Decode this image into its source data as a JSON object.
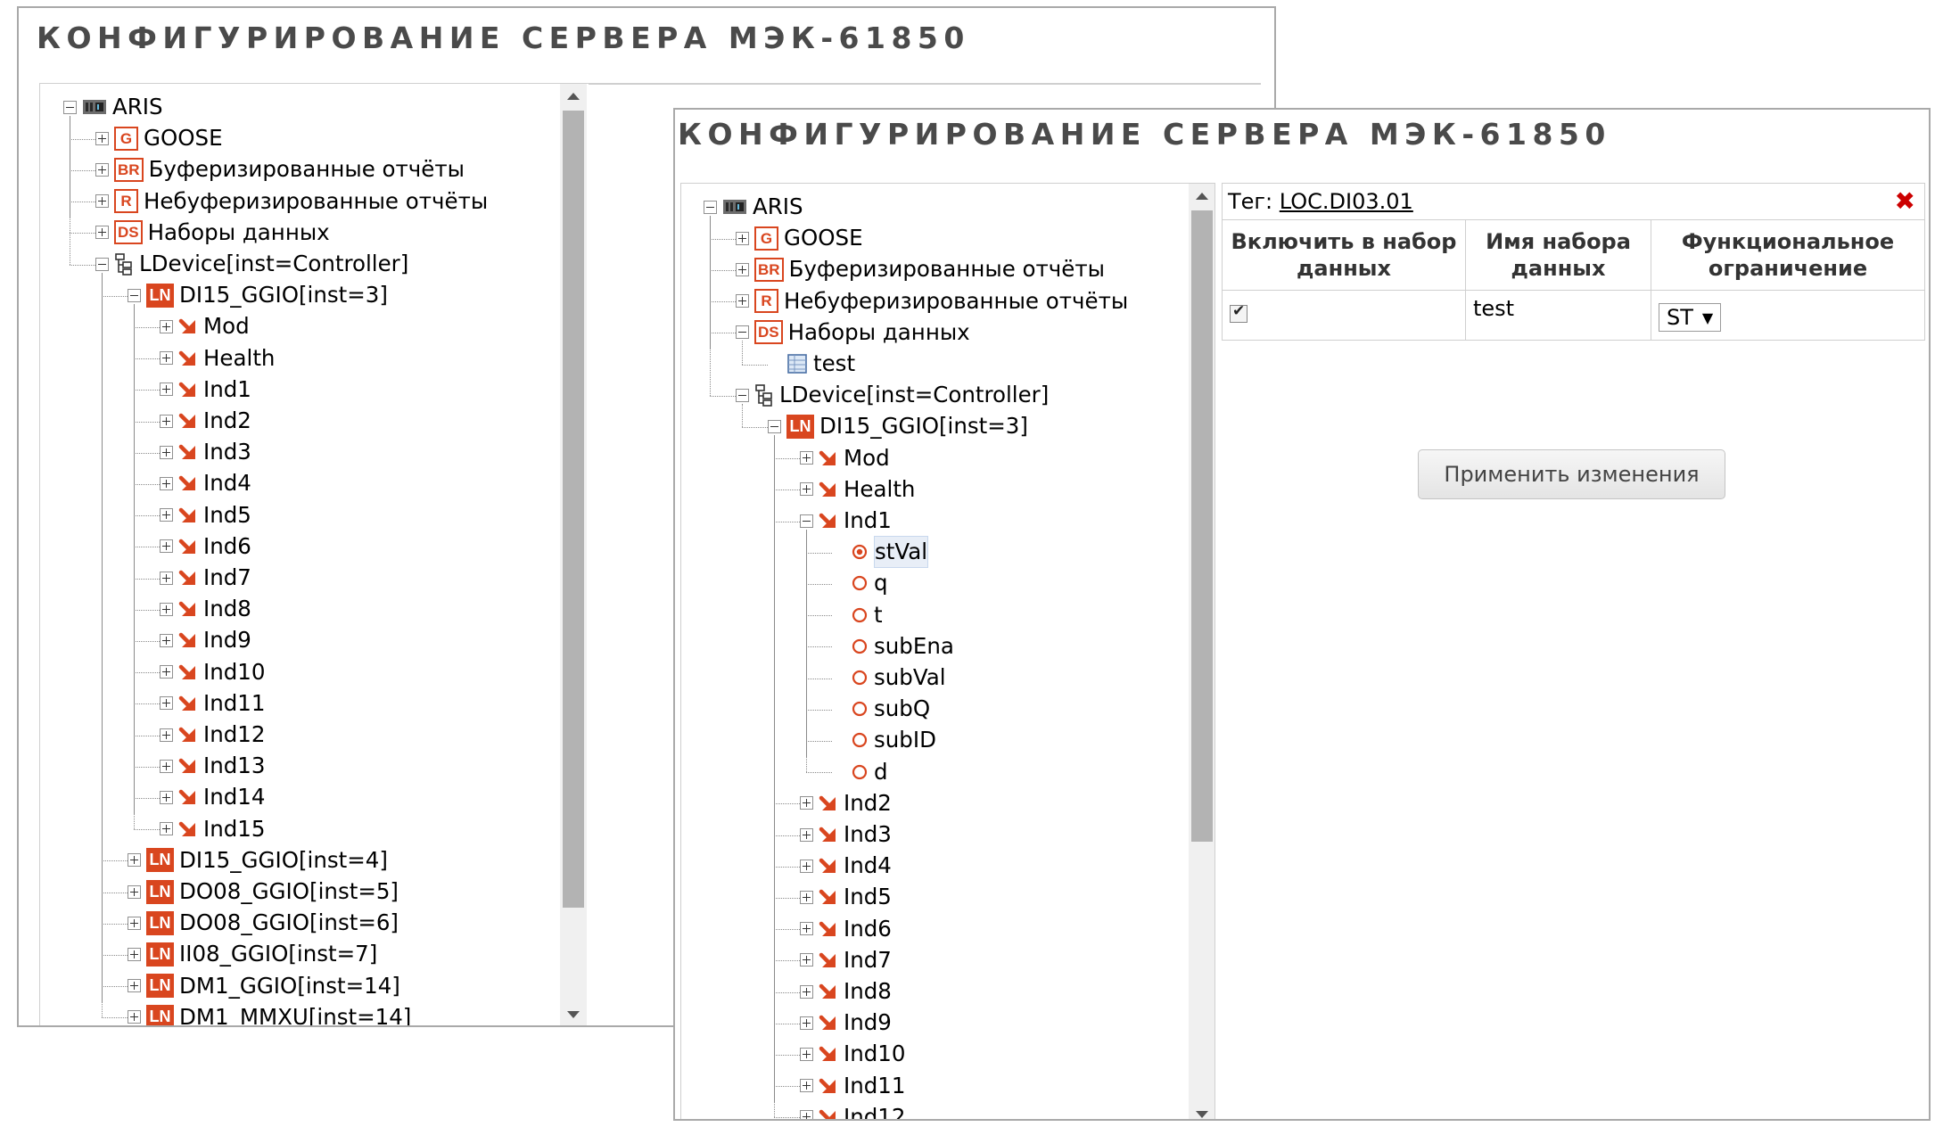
{
  "title": "КОНФИГУРИРОВАНИЕ СЕРВЕРА МЭК-61850",
  "back_tree": [
    {
      "depth": 0,
      "expander": "minus",
      "icon": "server-icon",
      "label": "ARIS"
    },
    {
      "depth": 1,
      "expander": "plus",
      "icon": "G",
      "label": "GOOSE"
    },
    {
      "depth": 1,
      "expander": "plus",
      "icon": "BR",
      "label": "Буферизированные отчёты"
    },
    {
      "depth": 1,
      "expander": "plus",
      "icon": "R",
      "label": "Небуферизированные отчёты"
    },
    {
      "depth": 1,
      "expander": "plus",
      "icon": "DS",
      "label": "Наборы данных"
    },
    {
      "depth": 1,
      "expander": "minus",
      "icon": "ldevice-icon",
      "label": "LDevice[inst=Controller]"
    },
    {
      "depth": 2,
      "expander": "minus",
      "icon": "LN",
      "label": "DI15_GGIO[inst=3]"
    },
    {
      "depth": 3,
      "expander": "plus",
      "icon": "arrow-icon",
      "label": "Mod"
    },
    {
      "depth": 3,
      "expander": "plus",
      "icon": "arrow-icon",
      "label": "Health"
    },
    {
      "depth": 3,
      "expander": "plus",
      "icon": "arrow-icon",
      "label": "Ind1"
    },
    {
      "depth": 3,
      "expander": "plus",
      "icon": "arrow-icon",
      "label": "Ind2"
    },
    {
      "depth": 3,
      "expander": "plus",
      "icon": "arrow-icon",
      "label": "Ind3"
    },
    {
      "depth": 3,
      "expander": "plus",
      "icon": "arrow-icon",
      "label": "Ind4"
    },
    {
      "depth": 3,
      "expander": "plus",
      "icon": "arrow-icon",
      "label": "Ind5"
    },
    {
      "depth": 3,
      "expander": "plus",
      "icon": "arrow-icon",
      "label": "Ind6"
    },
    {
      "depth": 3,
      "expander": "plus",
      "icon": "arrow-icon",
      "label": "Ind7"
    },
    {
      "depth": 3,
      "expander": "plus",
      "icon": "arrow-icon",
      "label": "Ind8"
    },
    {
      "depth": 3,
      "expander": "plus",
      "icon": "arrow-icon",
      "label": "Ind9"
    },
    {
      "depth": 3,
      "expander": "plus",
      "icon": "arrow-icon",
      "label": "Ind10"
    },
    {
      "depth": 3,
      "expander": "plus",
      "icon": "arrow-icon",
      "label": "Ind11"
    },
    {
      "depth": 3,
      "expander": "plus",
      "icon": "arrow-icon",
      "label": "Ind12"
    },
    {
      "depth": 3,
      "expander": "plus",
      "icon": "arrow-icon",
      "label": "Ind13"
    },
    {
      "depth": 3,
      "expander": "plus",
      "icon": "arrow-icon",
      "label": "Ind14"
    },
    {
      "depth": 3,
      "expander": "plus",
      "icon": "arrow-icon",
      "label": "Ind15"
    },
    {
      "depth": 2,
      "expander": "plus",
      "icon": "LN",
      "label": "DI15_GGIO[inst=4]"
    },
    {
      "depth": 2,
      "expander": "plus",
      "icon": "LN",
      "label": "DO08_GGIO[inst=5]"
    },
    {
      "depth": 2,
      "expander": "plus",
      "icon": "LN",
      "label": "DO08_GGIO[inst=6]"
    },
    {
      "depth": 2,
      "expander": "plus",
      "icon": "LN",
      "label": "II08_GGIO[inst=7]"
    },
    {
      "depth": 2,
      "expander": "plus",
      "icon": "LN",
      "label": "DM1_GGIO[inst=14]"
    },
    {
      "depth": 2,
      "expander": "plus",
      "icon": "LN",
      "label": "DM1_MMXU[inst=14]"
    }
  ],
  "front_tree": [
    {
      "depth": 0,
      "expander": "minus",
      "icon": "server-icon",
      "label": "ARIS"
    },
    {
      "depth": 1,
      "expander": "plus",
      "icon": "G",
      "label": "GOOSE"
    },
    {
      "depth": 1,
      "expander": "plus",
      "icon": "BR",
      "label": "Буферизированные отчёты"
    },
    {
      "depth": 1,
      "expander": "plus",
      "icon": "R",
      "label": "Небуферизированные отчёты"
    },
    {
      "depth": 1,
      "expander": "minus",
      "icon": "DS",
      "label": "Наборы данных"
    },
    {
      "depth": 2,
      "expander": "none",
      "icon": "dataset-icon",
      "label": "test"
    },
    {
      "depth": 1,
      "expander": "minus",
      "icon": "ldevice-icon",
      "label": "LDevice[inst=Controller]"
    },
    {
      "depth": 2,
      "expander": "minus",
      "icon": "LN",
      "label": "DI15_GGIO[inst=3]"
    },
    {
      "depth": 3,
      "expander": "plus",
      "icon": "arrow-icon",
      "label": "Mod"
    },
    {
      "depth": 3,
      "expander": "plus",
      "icon": "arrow-icon",
      "label": "Health"
    },
    {
      "depth": 3,
      "expander": "minus",
      "icon": "arrow-icon",
      "label": "Ind1"
    },
    {
      "depth": 4,
      "expander": "none",
      "icon": "radio-selected-icon",
      "label": "stVal",
      "selected": true
    },
    {
      "depth": 4,
      "expander": "none",
      "icon": "radio-icon",
      "label": "q"
    },
    {
      "depth": 4,
      "expander": "none",
      "icon": "radio-icon",
      "label": "t"
    },
    {
      "depth": 4,
      "expander": "none",
      "icon": "radio-icon",
      "label": "subEna"
    },
    {
      "depth": 4,
      "expander": "none",
      "icon": "radio-icon",
      "label": "subVal"
    },
    {
      "depth": 4,
      "expander": "none",
      "icon": "radio-icon",
      "label": "subQ"
    },
    {
      "depth": 4,
      "expander": "none",
      "icon": "radio-icon",
      "label": "subID"
    },
    {
      "depth": 4,
      "expander": "none",
      "icon": "radio-icon",
      "label": "d"
    },
    {
      "depth": 3,
      "expander": "plus",
      "icon": "arrow-icon",
      "label": "Ind2"
    },
    {
      "depth": 3,
      "expander": "plus",
      "icon": "arrow-icon",
      "label": "Ind3"
    },
    {
      "depth": 3,
      "expander": "plus",
      "icon": "arrow-icon",
      "label": "Ind4"
    },
    {
      "depth": 3,
      "expander": "plus",
      "icon": "arrow-icon",
      "label": "Ind5"
    },
    {
      "depth": 3,
      "expander": "plus",
      "icon": "arrow-icon",
      "label": "Ind6"
    },
    {
      "depth": 3,
      "expander": "plus",
      "icon": "arrow-icon",
      "label": "Ind7"
    },
    {
      "depth": 3,
      "expander": "plus",
      "icon": "arrow-icon",
      "label": "Ind8"
    },
    {
      "depth": 3,
      "expander": "plus",
      "icon": "arrow-icon",
      "label": "Ind9"
    },
    {
      "depth": 3,
      "expander": "plus",
      "icon": "arrow-icon",
      "label": "Ind10"
    },
    {
      "depth": 3,
      "expander": "plus",
      "icon": "arrow-icon",
      "label": "Ind11"
    },
    {
      "depth": 3,
      "expander": "plus",
      "icon": "arrow-icon",
      "label": "Ind12"
    }
  ],
  "details": {
    "tag_label": "Тег:",
    "tag_value": "LOC.DI03.01",
    "close_symbol": "✖",
    "headers": [
      "Включить в набор данных",
      "Имя набора данных",
      "Функциональное ограничение"
    ],
    "row": {
      "checked": true,
      "dataset_name": "test",
      "fc_value": "ST"
    },
    "dropdown_arrow": "▼",
    "apply_label": "Применить изменения"
  },
  "colors": {
    "accent": "#d9461f",
    "close": "#cc0000",
    "title": "#4a4a4a"
  }
}
